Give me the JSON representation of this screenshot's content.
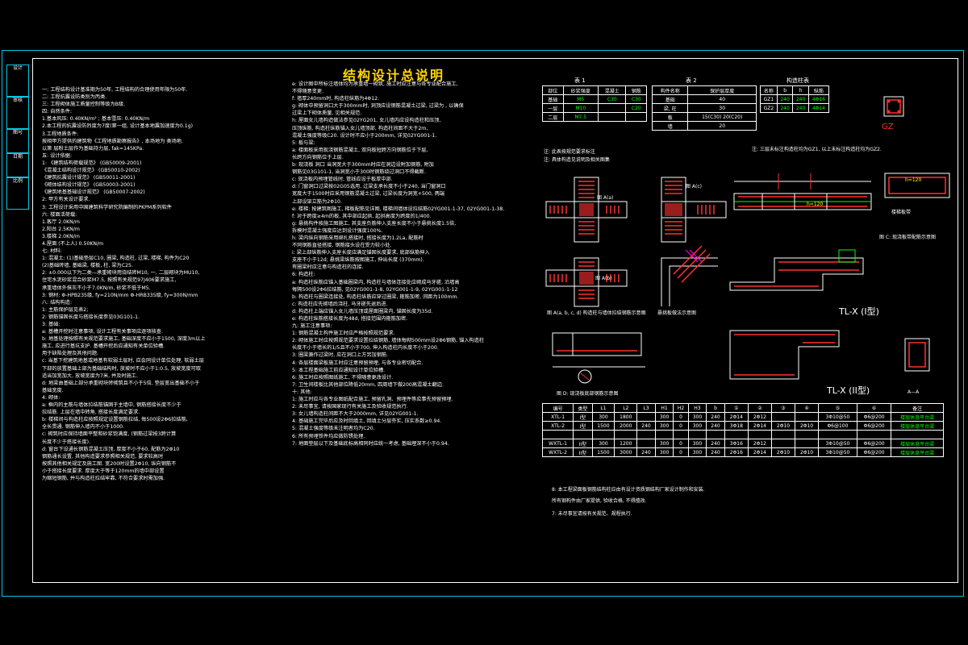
{
  "title": "结构设计总说明",
  "title_block": [
    "设计",
    "审核",
    "图号",
    "日期",
    "比例"
  ],
  "left_col": [
    "一: 工程结构设计基准期为50年, 工程结构的合理使用年限为50年.",
    "二: 工程抗震设防类别为丙类.",
    "三: 工程砌体施工质量控制等级为B级.",
    "四: 自然条件:",
    "  1.基本风压: 0.40KN/m² ; 基本雪压: 0.40KN/m",
    "  2.本工程的抗震设防烈度为7度(第一组, 设计基本地震加速度为0.1g)",
    "  3.工程地质条件:",
    "    按相甲方提供的建筑物《工程地质勘察报告》, 本场地为   类场地.",
    "  以第  层粉土层作为基础持力层, fak=145KPa.",
    "五: 设计依据:",
    "  1: 《建筑结构荷载规范》        (GB50009-2001)",
    "     《混凝土结构设计规范》      (GB50010-2002)",
    "     《建筑抗震设计规范》        (GB50011-2001)",
    "     《砌体结构设计规范》        (GB50003-2001)",
    "     《建筑地基基础设计规范》    (GB50007-2002)",
    "  2: 甲方有关设计要求.",
    "  3: 工程设计采用中国建筑科学研究院编制的PKPM系列软件",
    "六: 楼面活荷载:",
    "  1.客厅                       2.0KN/m",
    "  2.阳台                       2.5KN/m",
    "  3.楼梯                       2.0KN/m",
    "  4.屋面 (不上人)              0.50KN/m",
    "七: 材料:",
    "  1: 混凝土: (1)基础垫层C10, 圈梁, 构造柱, 过梁, 楼梯, 构件为C20",
    "       (2)基础砖墙, 基础梁, 楼板, 柱, 梁为C25.",
    "  2: ±0.000以下为二类—承重砌块用烧结砖M10, 一, 二层砌块为MU10,",
    "     住宅水泥砂浆混合砂浆M7.5, 按照有关规范97J406要求施工,",
    "     承重墙体外抹灰不小于7.0KN/m, 砂浆不低于M5.",
    "  3: 钢材: Φ-HPB235级, fy=210N/mm    Φ-HRB335级, fy=300N/mm",
    "八: 结构构造:",
    "  1: 主筋保护层见表2;",
    "  2: 钢筋锚固长度与搭接长度参见03G101-1.",
    "  3: 基础:",
    "    a: 基槽开挖时注意事项, 设计工程有关事项应逐项核查.",
    "    b: 地基处理按照有关规范要求施工, 基础深度不应小于1500, 深度3m以上",
    "       施工, 应进行基坑支护. 基槽开挖后应通知有关单位验槽.",
    "       用于缺陷处理及其他问题.",
    "    c: 当基下挖建筑地基或地基有软弱土层时, 应会同设计单位处理, 软弱土层",
    "       下部的放置基础上部为基础结构时, 放坡时不应小于1:0.5, 放坡宽度可取",
    "       适当加宽加大, 放坡宽度为7米, 并及时施工.",
    "    d: 地梁由基础上部分承重砌块砖砌筑且不小于5倍, 垫层宽出基础不小于",
    "       基础宽度.",
    "  4: 砌体:",
    "    a: 框内的主筋与墙体拉结筋锚固于主墙中, 钢筋搭接长度不少于",
    "       拉结筋. 上层在墙中转角, 搭接长度满足要求.",
    "    b: 楼梯间与构造柱应按照规定设置钢筋拉结, 每500设2Φ6拉结筋,",
    "       全长贯通. 钢筋伸入墙内不小于1000.",
    "    c: 砌筑时应保持墙面平整和砂浆饱满度, (钢筋过梁按3跨计算",
    "       长度不少于搭接长度).",
    "    d: 窗台下设通长钢筋混凝土压顶, 厚度不小于60, 配筋为2Φ10",
    "       钢筋通长设置, 其他构造要求参照相关规范, 要求较高时",
    "       按照其他相关规定及施工图. 宽200时设置2Φ10, 纵向钢筋不",
    "       小于搭接长度要求.  厚度大于等于120mm的墙中部设置",
    "       为缩短钢筋, 并与构造柱拉结牢靠, 不符合要求时需加强."
  ],
  "mid_col": [
    "e: 设计图中所标注墙体均为承重墙一砌筑, 施工时应注意与各专业配合施工,",
    "   不得随意变更.",
    "f: 墙厚240mm时, 构造柱纵筋为4Φ12.",
    "g: 砌体中预留洞口大于300mm时, 洞顶应设钢筋混凝土过梁, 过梁为     , 以确保",
    "   过梁上下砌体质量, 见相关规范.",
    "h: 屋面女儿墙构造做法参见02YG201, 女儿墙内应设构造柱和压顶,",
    "   压顶纵筋, 构造柱纵筋锚入女儿墙顶部, 构造柱间距不大于2m,",
    "   混凝土强度等级C20. 设计时不应小于200mm, 详见02YG001-1.",
    "5: 板与梁:",
    "  a: 楼面板采用现浇钢筋混凝土, 双向板短跨方向钢筋位于下层,",
    "     长跨方向钢筋位于上层.",
    "  b: 现浇板 洞口 当洞宽大于300mm时应在洞边设附加钢筋, 附加",
    "     钢筋见03G101-1, 当洞宽小于300时钢筋绕过洞口不得截断.",
    "  c: 现浇板内预埋管线时, 管线应设于板厚中部.",
    "  d: 门窗洞口过梁按02G05选用, 过梁支承长度不小于240, 当门窗洞口",
    "     宽度大于1500时应采用钢筋混凝土过梁, 过梁长度为洞宽+500, 两端",
    "     上部设架立筋为2Φ10.",
    "  e: 楼梯: 按建筑图施工, 梯板配筋见详图, 楼梯间墙体设拉结筋02YG001-1-37, 02YG001-1-38.",
    "  f: 对于跨度≥4m的板, 其中部应起拱, 起拱高度为跨度的1/400.",
    "  g: 悬挑构件按施工图施工, 其支座负筋伸入支座长度不小于悬挑长度1.5倍,",
    "     拆模时混凝土强度应达到设计强度100%.",
    "  h: 梁内纵向钢筋采用绑扎搭接时, 搭接长度为1.2La, 配筋时",
    "     不同钢筋直径搭接. 钢筋接头设在受力较小处.",
    "  i: 梁上部纵筋伸入支座长度应满足锚固长度要求, 底部纵筋伸入",
    "     支座不小于12d; 悬挑梁纵筋按图施工, 伸出长度 (370mm).",
    "     有圈梁时应注意与构造柱的连接.",
    "6: 构造柱:",
    "  a: 构造柱纵筋应锚入基础圈梁内, 构造柱与墙体连接处应砌成马牙槎, 沿墙高",
    "     每隔500设2Φ6拉结筋, 见02YG001-1-8, 02YG001-1-9, 02YG001-1-12",
    "  b: 构造柱与圈梁连接处, 构造柱纵筋应穿过圈梁, 箍筋加密, 间距为100mm.",
    "  c: 构造柱应先砌墙后浇柱, 马牙槎先退后进.",
    "  d: 构造柱上端应锚入女儿墙压顶或屋面圈梁内, 锚固长度为35d.",
    "  e: 构造柱纵筋搭接长度为48d, 搭接范围内箍筋加密.",
    "九: 施工注意事项:",
    "  1: 钢筋混凝土构件施工时应严格按照规范要求.",
    "  2: 砌体施工时应按照规范要求设置拉结钢筋, 墙体每砌500mm设2Φ6钢筋, 锚入构造柱",
    "     长度不小于墙长的1/5且不小于700, 伸入构造柱内长度不小于200.",
    "  3: 圈梁兼作过梁时, 应在洞口上方另加钢筋.",
    "  4: 各层楼面梁板施工时应注意预留预埋, 与各专业密切配合.",
    "  5: 本工程基础施工前应通知设计单位验槽.",
    "  6: 施工时应按照图纸施工, 不得随意更改设计.",
    "  7: 卫生间楼板比其他部位降低20mm, 四周墙下做200高混凝土翻边.",
    "十: 其他:",
    "  1: 施工时应与各专业图纸配合施工, 预留孔洞、预埋件等应事先预留预埋.",
    "  2: 未尽事宜, 请按国家现行有关施工及验收规范执行.",
    "  3: 女儿墙构造柱间距不大于2000mm, 详见02YG001-1.",
    "  4: 基础施工完毕后应及时回填土, 回填土分层夯实, 压实系数≥0.94.",
    "  5: 混凝土强度等级未注明者均为C20.",
    "  6: 所有预埋铁件均应做防锈处理.",
    "  7: 地面垫层以下及基础底标高相同时应统一考虑, 基础埋深不小于0.94."
  ],
  "table1": {
    "title": "表 1",
    "header": [
      "部位",
      "砂浆强度",
      "混凝土",
      "钢筋"
    ],
    "rows": [
      [
        "基础",
        "M5",
        "C30",
        "C30"
      ],
      [
        "一层",
        "M10",
        "",
        "C20"
      ],
      [
        "二层",
        "M7.5",
        "",
        ""
      ]
    ],
    "note1": "注: 此表按规范要求标注",
    "note2": "注: 具体构造见说明及相关图集"
  },
  "table2": {
    "title": "表 2",
    "header": [
      "构件名称",
      "保护层厚度"
    ],
    "rows": [
      [
        "基础",
        "40"
      ],
      [
        "梁, 柱",
        "30"
      ],
      [
        "板",
        "15(C30) 20(C20)"
      ],
      [
        "墙",
        "20"
      ]
    ]
  },
  "table3": {
    "title": "构造柱表",
    "header": [
      "名称",
      "b",
      "h",
      "纵筋"
    ],
    "rows": [
      [
        "GZ1",
        "240",
        "240",
        "4Φ16"
      ],
      [
        "GZ2",
        "240",
        "240",
        "4Φ14"
      ]
    ],
    "note": "注: 三层未标注构造柱均为GZ1, 以上未标注构造柱均为GZ2."
  },
  "gz_label": "GZ",
  "fig_labels": {
    "a": "图 A(a)",
    "b": "图 A(b)",
    "c": "图 A(c)",
    "d": "图 A(d)",
    "fig_a_caption": "图 A(a, b, c, d) 构造柱与墙体拉结钢筋示意图",
    "fig_b_caption": "悬挑板做法示意图",
    "fig_c_caption": "图 C: 现浇板带配筋示意图",
    "fig_d_caption": "图 D: 现浇板底部钢筋示意图",
    "tl1": "TL-X (I型)",
    "tl2": "TL-X (II型)",
    "aa": "A—A",
    "label_slab": "楼梯板带",
    "label_h": "h=120",
    "label_h2": "h=120"
  },
  "bottom_table": {
    "header": [
      "编号",
      "类型",
      "L1",
      "L2",
      "L3",
      "H1",
      "H2",
      "H3",
      "b",
      "①",
      "②",
      "③",
      "④",
      "⑤",
      "⑥",
      "备注"
    ],
    "rows": [
      [
        "XTL-1",
        "I型",
        "300",
        "1800",
        "",
        "300",
        "0",
        "300",
        "240",
        "2Φ14",
        "2Φ12",
        "",
        "",
        "3Φ10@50",
        "Φ6@200",
        "楼层休息平台梁"
      ],
      [
        "XTL-2",
        "I型",
        "1500",
        "2000",
        "240",
        "300",
        "0",
        "300",
        "240",
        "3Φ18",
        "2Φ14",
        "2Φ10",
        "2Φ10",
        "Φ6@100",
        "Φ6@200",
        "楼层休息平台梁"
      ],
      [
        "",
        "",
        "",
        "",
        "",
        "",
        "",
        "",
        "",
        "",
        "",
        "",
        "",
        "",
        "",
        ""
      ],
      [
        "WXTL-1",
        "II型",
        "300",
        "1200",
        "",
        "300",
        "0",
        "300",
        "240",
        "3Φ16",
        "2Φ12",
        "",
        "",
        "3Φ10@50",
        "Φ6@200",
        "楼层休息平台梁"
      ],
      [
        "WXTL-2",
        "II型",
        "1500",
        "3000",
        "240",
        "300",
        "0",
        "300",
        "240",
        "2Φ16",
        "2Φ14",
        "2Φ10",
        "2Φ10",
        "3Φ10@50",
        "Φ6@200",
        "楼层休息平台梁"
      ]
    ],
    "notes": [
      "8: 本工程梁面板钢筋结构柱应由有设计资质钢结构厂家设计制作和安装.",
      "   所有钢构件由厂家提供, 验收合格, 不得擅改.",
      "7: 未尽事宜请按有关规范、规程执行."
    ]
  },
  "colors": {
    "frame": "#00c8e6",
    "title": "#ffd700",
    "rebar": "#ff3030",
    "hatch": "#ff00ff"
  }
}
